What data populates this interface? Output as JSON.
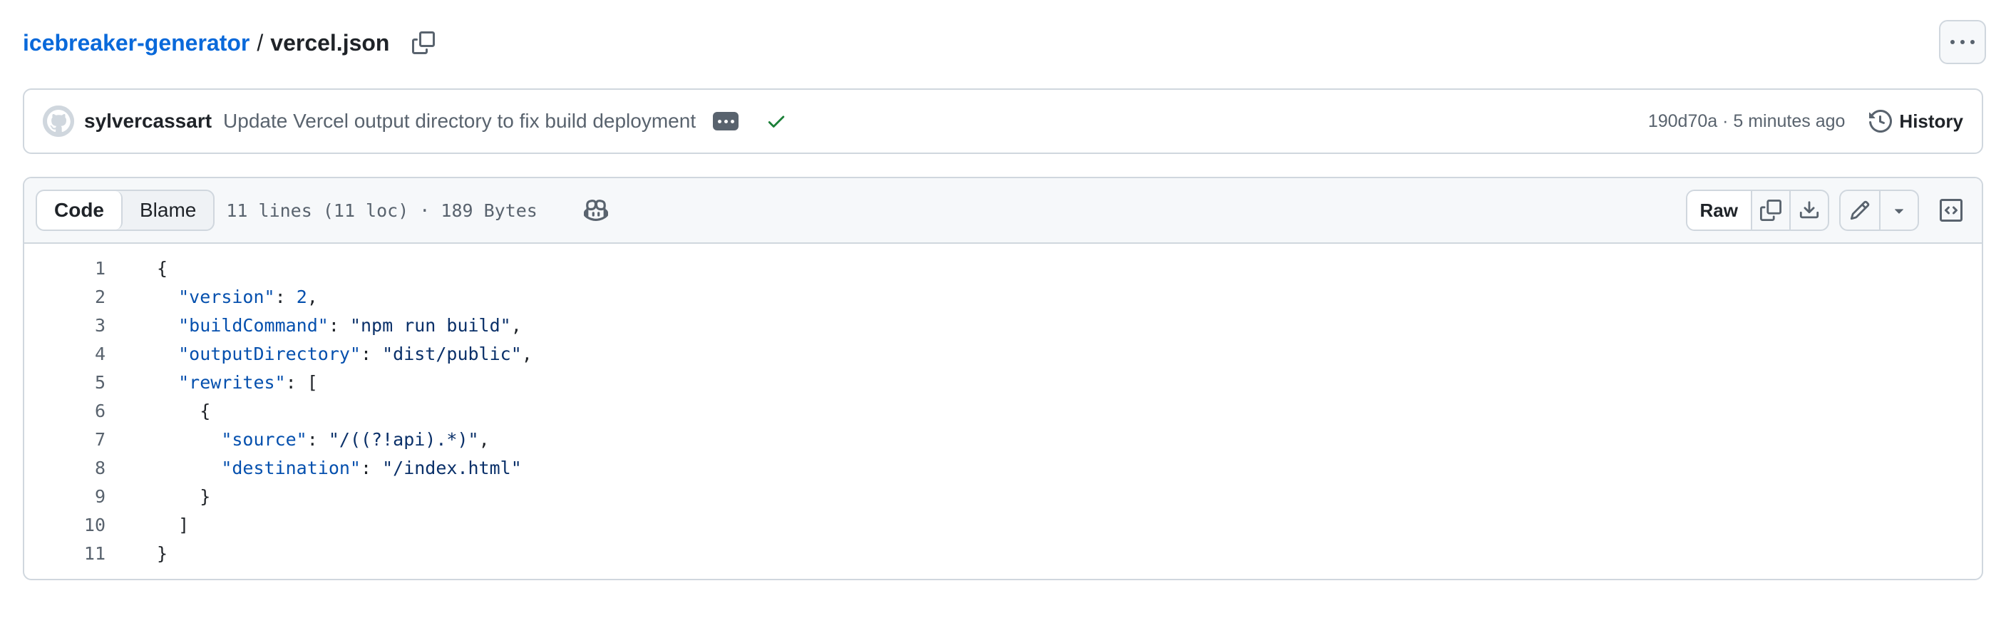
{
  "breadcrumb": {
    "repo": "icebreaker-generator",
    "separator": "/",
    "file": "vercel.json"
  },
  "commit": {
    "author": "sylvercassart",
    "message": "Update Vercel output directory to fix build deployment",
    "meta": "190d70a · 5 minutes ago",
    "history_label": "History",
    "status_color": "#1a7f37"
  },
  "file_header": {
    "tabs": [
      {
        "label": "Code",
        "active": true
      },
      {
        "label": "Blame",
        "active": false
      }
    ],
    "info": "11 lines (11 loc) · 189 Bytes",
    "raw_label": "Raw"
  },
  "code": {
    "line_numbers": [
      "1",
      "2",
      "3",
      "4",
      "5",
      "6",
      "7",
      "8",
      "9",
      "10",
      "11"
    ],
    "lines": [
      "{",
      "  \"version\": 2,",
      "  \"buildCommand\": \"npm run build\",",
      "  \"outputDirectory\": \"dist/public\",",
      "  \"rewrites\": [",
      "    {",
      "      \"source\": \"/((?!api).*)\",",
      "      \"destination\": \"/index.html\"",
      "    }",
      "  ]",
      "}"
    ]
  },
  "colors": {
    "link": "#0969da",
    "border": "#d0d7de",
    "muted": "#59636e",
    "success": "#1a7f37"
  }
}
